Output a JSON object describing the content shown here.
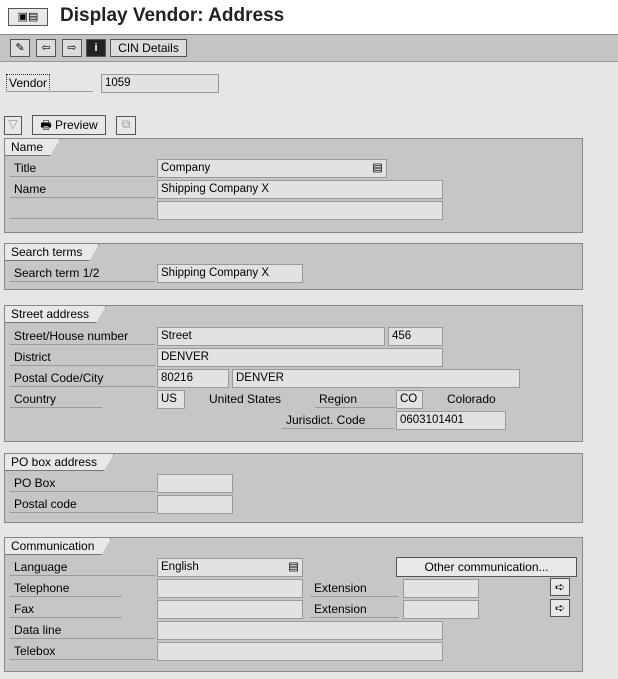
{
  "title": "Display Vendor: Address",
  "toolbar": {
    "cin_details": "CIN Details"
  },
  "vendor": {
    "label": "Vendor",
    "value": "1059"
  },
  "actions": {
    "preview": "Preview"
  },
  "name_group": {
    "title": "Name",
    "title_label": "Title",
    "title_value": "Company",
    "name_label": "Name",
    "name_value": "Shipping Company X",
    "name2_value": ""
  },
  "search_group": {
    "title": "Search terms",
    "label": "Search term 1/2",
    "value": "Shipping Company X"
  },
  "street_group": {
    "title": "Street address",
    "street_label": "Street/House number",
    "street": "Street",
    "house_number": "456",
    "district_label": "District",
    "district": "DENVER",
    "postal_label": "Postal Code/City",
    "postal_code": "80216",
    "city": "DENVER",
    "country_label": "Country",
    "country": "US",
    "country_name": "United States",
    "region_label": "Region",
    "region": "CO",
    "region_name": "Colorado",
    "jurisdiction_label": "Jurisdict. Code",
    "jurisdiction": "0603101401"
  },
  "po_group": {
    "title": "PO box address",
    "po_box_label": "PO Box",
    "po_box": "",
    "postal_label": "Postal code",
    "postal_code": ""
  },
  "comm_group": {
    "title": "Communication",
    "language_label": "Language",
    "language": "English",
    "other_comm": "Other communication...",
    "telephone_label": "Telephone",
    "telephone": "",
    "extension_label": "Extension",
    "tel_extension": "",
    "fax_label": "Fax",
    "fax": "",
    "fax_extension": "",
    "dataline_label": "Data line",
    "dataline": "",
    "telebox_label": "Telebox",
    "telebox": ""
  }
}
